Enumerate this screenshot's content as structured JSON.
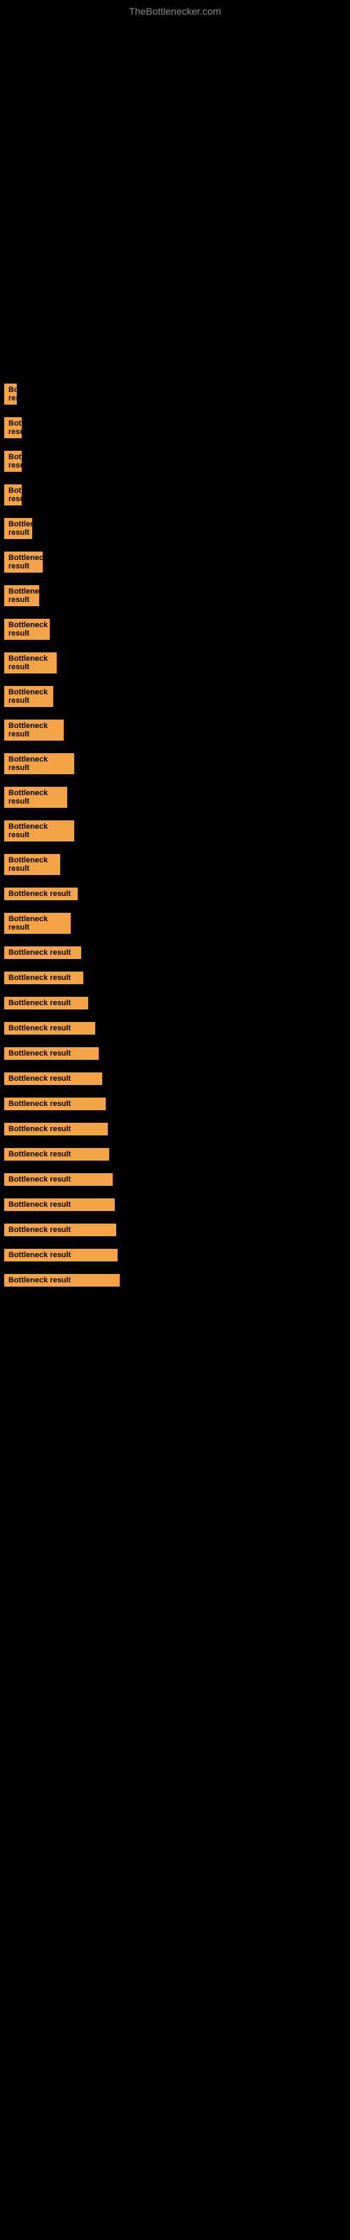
{
  "site": {
    "title": "TheBottlenecker.com"
  },
  "bottleneck_label": "Bottleneck result",
  "rows": [
    {
      "id": 1,
      "label": "Bottleneck result",
      "width_class": "w-tiny"
    },
    {
      "id": 2,
      "label": "Bottleneck result",
      "width_class": "w-tiny"
    },
    {
      "id": 3,
      "label": "Bottleneck result",
      "width_class": "w-small"
    },
    {
      "id": 4,
      "label": "Bottleneck result",
      "width_class": "w-small"
    },
    {
      "id": 5,
      "label": "Bottleneck result",
      "width_class": "w-small"
    },
    {
      "id": 6,
      "label": "Bottleneck result",
      "width_class": "w-medium-sm"
    },
    {
      "id": 7,
      "label": "Bottleneck result",
      "width_class": "w-medium-sm"
    },
    {
      "id": 8,
      "label": "Bottleneck result",
      "width_class": "w-medium-sm"
    },
    {
      "id": 9,
      "label": "Bottleneck result",
      "width_class": "w-medium"
    },
    {
      "id": 10,
      "label": "Bottleneck result",
      "width_class": "w-medium"
    },
    {
      "id": 11,
      "label": "Bottleneck result",
      "width_class": "w-medium"
    },
    {
      "id": 12,
      "label": "Bottleneck result",
      "width_class": "w-medium-lg"
    },
    {
      "id": 13,
      "label": "Bottleneck result",
      "width_class": "w-medium-lg"
    },
    {
      "id": 14,
      "label": "Bottleneck result",
      "width_class": "w-medium-lg"
    },
    {
      "id": 15,
      "label": "Bottleneck result",
      "width_class": "w-large"
    },
    {
      "id": 16,
      "label": "Bottleneck result",
      "width_class": "w-large"
    },
    {
      "id": 17,
      "label": "Bottleneck result",
      "width_class": "w-large"
    },
    {
      "id": 18,
      "label": "Bottleneck result",
      "width_class": "w-xlarge"
    },
    {
      "id": 19,
      "label": "Bottleneck result",
      "width_class": "w-xlarge"
    },
    {
      "id": 20,
      "label": "Bottleneck result",
      "width_class": "w-xlarge"
    },
    {
      "id": 21,
      "label": "Bottleneck result",
      "width_class": "w-full"
    },
    {
      "id": 22,
      "label": "Bottleneck result",
      "width_class": "w-full"
    },
    {
      "id": 23,
      "label": "Bottleneck result",
      "width_class": "w-full"
    },
    {
      "id": 24,
      "label": "Bottleneck result",
      "width_class": "w-fuller"
    },
    {
      "id": 25,
      "label": "Bottleneck result",
      "width_class": "w-fuller"
    },
    {
      "id": 26,
      "label": "Bottleneck result",
      "width_class": "w-fuller"
    },
    {
      "id": 27,
      "label": "Bottleneck result",
      "width_class": "w-fuller"
    },
    {
      "id": 28,
      "label": "Bottleneck result",
      "width_class": "w-fuller"
    },
    {
      "id": 29,
      "label": "Bottleneck result",
      "width_class": "w-fuller"
    },
    {
      "id": 30,
      "label": "Bottleneck result",
      "width_class": "w-fuller"
    }
  ]
}
